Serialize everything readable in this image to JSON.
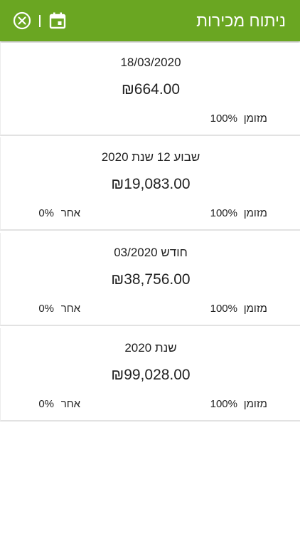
{
  "header": {
    "title": "ניתוח מכירות",
    "close_icon": "close-circle-icon",
    "calendar_icon": "calendar-icon"
  },
  "colors": {
    "appbar": "#6aa622",
    "text": "#222222",
    "divider": "#e2e2e2"
  },
  "cards": [
    {
      "period": "18/03/2020",
      "amount": "₪664.00",
      "cash_label": "מזומן",
      "cash_percent": "100%"
    },
    {
      "period": "שבוע 12 שנת 2020",
      "amount": "₪19,083.00",
      "cash_label": "מזומן",
      "cash_percent": "100%",
      "other_label": "אחר",
      "other_percent": "0%"
    },
    {
      "period": "חודש 03/2020",
      "amount": "₪38,756.00",
      "cash_label": "מזומן",
      "cash_percent": "100%",
      "other_label": "אחר",
      "other_percent": "0%"
    },
    {
      "period": "שנת 2020",
      "amount": "₪99,028.00",
      "cash_label": "מזומן",
      "cash_percent": "100%",
      "other_label": "אחר",
      "other_percent": "0%"
    }
  ]
}
